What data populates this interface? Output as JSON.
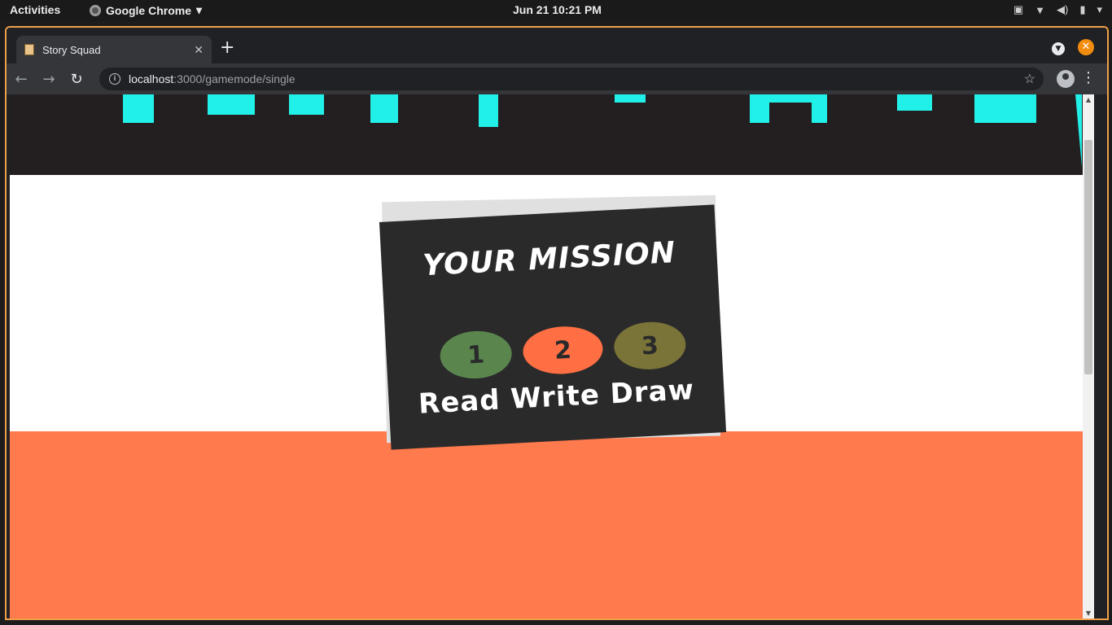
{
  "topbar": {
    "activities": "Activities",
    "app_name": "Google Chrome",
    "clock": "Jun 21  10:21 PM"
  },
  "browser": {
    "tab_title": "Story Squad",
    "url_host": "localhost",
    "url_path": ":3000/gamemode/single"
  },
  "page": {
    "mission_title": "YOUR MISSION",
    "steps": [
      {
        "number": "1",
        "color": "#5a864e"
      },
      {
        "number": "2",
        "color": "#ff6f43"
      },
      {
        "number": "3",
        "color": "#7a7438"
      }
    ],
    "step_labels": "Read Write Draw",
    "colors": {
      "hero_bg": "#231f20",
      "hero_accent": "#21f0e8",
      "card_bg": "#2b2a2b",
      "orange_section": "#ff7a4d",
      "window_border": "#f0a04a"
    }
  }
}
